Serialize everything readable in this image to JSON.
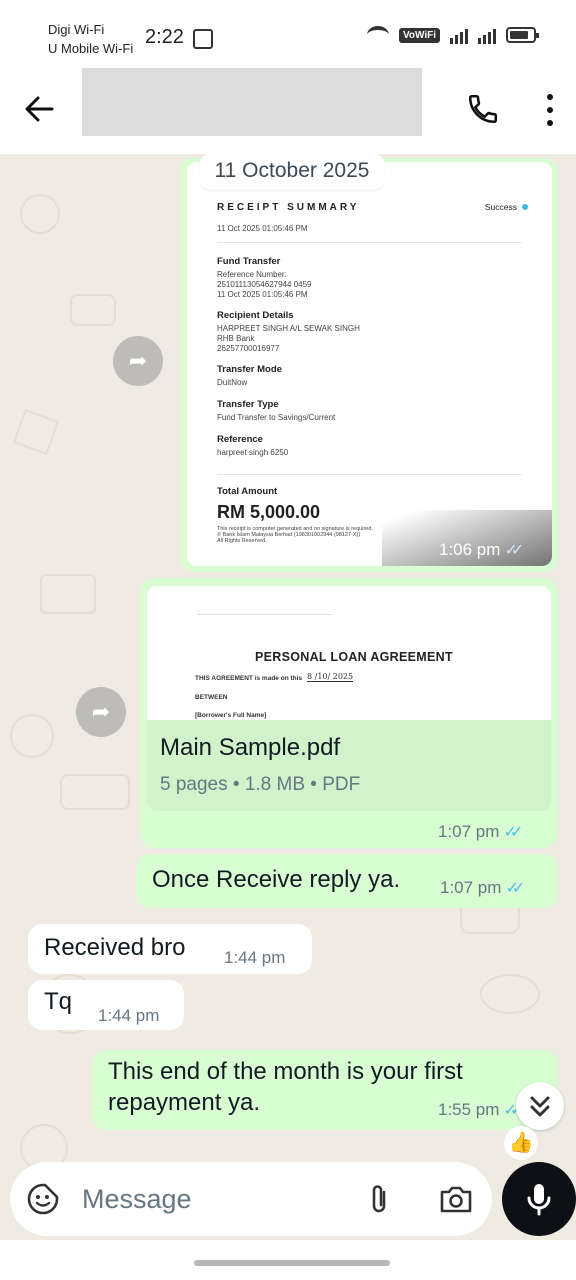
{
  "status_bar": {
    "carrier_line1": "Digi Wi-Fi",
    "carrier_line2": "U Mobile Wi-Fi",
    "time": "2:22",
    "volte_badge": "VoWiFi"
  },
  "header": {
    "back_icon": "arrow-left-icon",
    "call_icon": "phone-icon",
    "menu_icon": "more-vertical-icon"
  },
  "chat": {
    "date_label": "11 October 2025",
    "receipt": {
      "title": "RECEIPT SUMMARY",
      "status": "Success",
      "timestamp": "11 Oct 2025 01:05:46 PM",
      "fund_transfer_label": "Fund Transfer",
      "reference_number_label": "Reference Number:",
      "reference_number": "25101113054627944 0459",
      "reference_datetime": "11 Oct 2025 01:05:46 PM",
      "recipient_label": "Recipient Details",
      "recipient_name": "HARPREET SINGH A/L SEWAK SINGH",
      "recipient_bank": "RHB Bank",
      "recipient_account": "26257700016977",
      "transfer_mode_label": "Transfer Mode",
      "transfer_mode": "DuitNow",
      "transfer_type_label": "Transfer Type",
      "transfer_type": "Fund Transfer to Savings/Current",
      "reference_label": "Reference",
      "reference": "harpreet singh 6250",
      "total_label": "Total Amount",
      "total_amount": "RM 5,000.00",
      "footer": "This receipt is computer generated and no signature is required.",
      "footer2": "© Bank Islam Malaysia Berhad (198301002944 (98127-X))",
      "footer3": "All Rights Reserved.",
      "sent_time": "1:06 pm"
    },
    "pdf": {
      "preview_heading": "PERSONAL LOAN AGREEMENT",
      "preview_line1": "THIS AGREEMENT is made on this",
      "preview_date": "8 /10/ 2025",
      "preview_between": "BETWEEN",
      "preview_borrower": "[Borrower's Full Name]",
      "file_name": "Main Sample.pdf",
      "meta": "5 pages • 1.8 MB • PDF",
      "sent_time": "1:07 pm"
    },
    "messages": [
      {
        "direction": "out",
        "text": "Once Receive reply ya.",
        "time": "1:07 pm"
      },
      {
        "direction": "in",
        "text": "Received bro",
        "time": "1:44 pm"
      },
      {
        "direction": "in",
        "text": "Tq",
        "time": "1:44 pm"
      },
      {
        "direction": "out",
        "text": "This end of the month is your first repayment ya.",
        "time": "1:55 pm"
      }
    ],
    "reaction": "👍"
  },
  "composer": {
    "placeholder": "Message",
    "emoji_icon": "sticker-icon",
    "attach_icon": "paperclip-icon",
    "camera_icon": "camera-icon",
    "mic_icon": "mic-icon"
  },
  "colors": {
    "outgoing_bubble": "#d9fdd3",
    "incoming_bubble": "#ffffff",
    "wallpaper": "#efeae2",
    "read_ticks": "#53bdeb"
  }
}
